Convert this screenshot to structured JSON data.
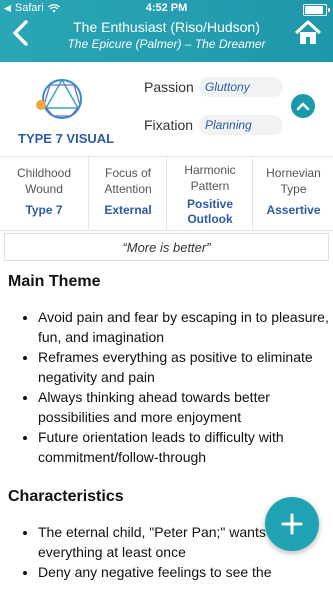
{
  "status_bar": {
    "carrier": "Safari",
    "time": "4:52 PM"
  },
  "header": {
    "title": "The Enthusiast (Riso/Hudson)",
    "subtitle": "The Epicure (Palmer) – The Dreamer",
    "colors": {
      "accent": "#1f97aa"
    }
  },
  "visual": {
    "type_label": "TYPE 7 VISUAL",
    "passion_label": "Passion",
    "passion_value": "Gluttony",
    "fixation_label": "Fixation",
    "fixation_value": "Planning"
  },
  "attributes": [
    {
      "header": "Childhood Wound",
      "value": "Type 7"
    },
    {
      "header": "Focus of Attention",
      "value": "External"
    },
    {
      "header": "Harmonic Pattern",
      "value": "Positive Outlook"
    },
    {
      "header": "Hornevian Type",
      "value": "Assertive"
    }
  ],
  "quote": "“More is better”",
  "main_theme": {
    "title": "Main Theme",
    "items": [
      "Avoid pain and fear by escaping in to pleasure, fun, and imagination",
      "Reframes everything as positive to eliminate negativity and pain",
      "Always thinking ahead towards better possibilities and more enjoyment",
      "Future orientation leads to difficulty with commitment/follow-through"
    ]
  },
  "characteristics": {
    "title": "Characteristics",
    "items": [
      "The eternal child, \"Peter Pan;\" wants to try everything at least once",
      "Deny any negative feelings to see the"
    ]
  }
}
